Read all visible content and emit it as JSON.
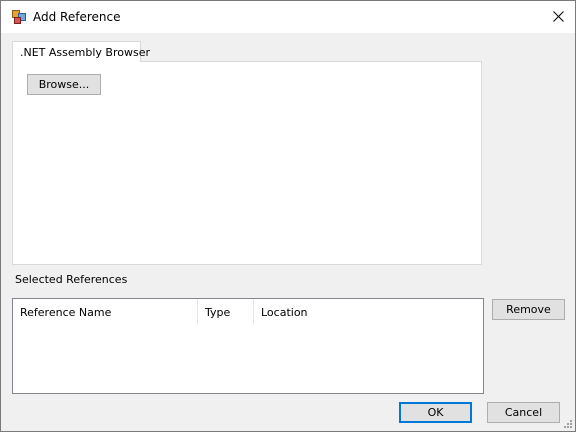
{
  "window": {
    "title": "Add Reference"
  },
  "tabs": [
    {
      "label": ".NET Assembly Browser",
      "selected": true
    }
  ],
  "browse_button": {
    "label": "Browse..."
  },
  "selected_references": {
    "label": "Selected References",
    "columns": [
      "Reference Name",
      "Type",
      "Location"
    ],
    "rows": []
  },
  "buttons": {
    "remove": "Remove",
    "ok": "OK",
    "cancel": "Cancel"
  },
  "colors": {
    "dialog_bg": "#f0f0f0",
    "focus_accent": "#0078d7"
  },
  "icons": {
    "app": "add-reference-app-icon",
    "close": "close-icon",
    "grip": "resize-grip-icon"
  }
}
